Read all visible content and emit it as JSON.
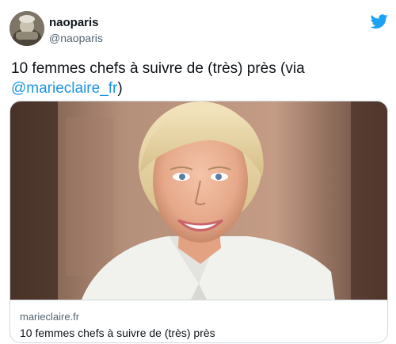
{
  "user": {
    "display_name": "naoparis",
    "handle": "@naoparis",
    "avatar_icon": "profile-avatar"
  },
  "brand_icon": "twitter-bird-icon",
  "colors": {
    "brand": "#1da1f2",
    "mention": "#1b95e0",
    "text": "#0f1419",
    "muted": "#536471",
    "border": "#cfd9de"
  },
  "tweet": {
    "text_before": "10 femmes chefs à suivre de (très) près (via ",
    "mention": "@marieclaire_fr",
    "text_after": ")"
  },
  "card": {
    "domain": "marieclaire.fr",
    "title": "10 femmes chefs à suivre de (très) près"
  }
}
